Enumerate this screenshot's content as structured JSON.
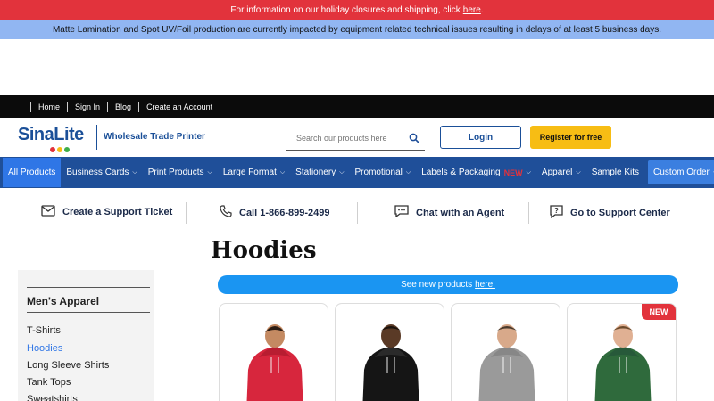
{
  "alerts": {
    "holiday_text": "For information on our holiday closures and shipping, click",
    "holiday_link": "here",
    "holiday_end": ".",
    "production_notice": "Matte Lamination and Spot UV/Foil production are currently impacted by equipment related technical issues resulting in delays of at least 5 business days."
  },
  "topnav": {
    "items": [
      "Home",
      "Sign In",
      "Blog",
      "Create an Account"
    ]
  },
  "header": {
    "logo_text": "SinaLite",
    "logo_dot_colors": [
      "#e2333c",
      "#f7bd14",
      "#3fae49"
    ],
    "tagline": "Wholesale Trade Printer",
    "search_placeholder": "Search our products here",
    "login_label": "Login",
    "register_label": "Register for free"
  },
  "mainnav": {
    "items": [
      {
        "label": "All Products"
      },
      {
        "label": "Business Cards"
      },
      {
        "label": "Print Products"
      },
      {
        "label": "Large Format"
      },
      {
        "label": "Stationery"
      },
      {
        "label": "Promotional"
      },
      {
        "label": "Labels & Packaging",
        "badge": "NEW"
      },
      {
        "label": "Apparel"
      },
      {
        "label": "Sample Kits"
      },
      {
        "label": "Custom Order"
      }
    ]
  },
  "support": {
    "ticket": "Create a Support Ticket",
    "call": "Call 1-866-899-2499",
    "chat": "Chat with an Agent",
    "center": "Go to Support Center"
  },
  "page": {
    "title": "Hoodies"
  },
  "sidebar": {
    "heading": "Men's Apparel",
    "items": [
      "T-Shirts",
      "Hoodies",
      "Long Sleeve Shirts",
      "Tank Tops",
      "Sweatshirts"
    ],
    "active_item": "Hoodies"
  },
  "banner": {
    "text": "See new products",
    "link": "here."
  },
  "products": [
    {
      "hoodie_color": "#d7263d"
    },
    {
      "hoodie_color": "#151515"
    },
    {
      "hoodie_color": "#9a9a9a"
    },
    {
      "hoodie_color": "#2f6a3c",
      "badge": "NEW"
    }
  ],
  "colors": {
    "alert_red": "#e2333c",
    "alert_blue": "#91b6f2",
    "brand_blue": "#1f4f99",
    "accent_yellow": "#f7bd14",
    "link_blue": "#2f76e6"
  }
}
